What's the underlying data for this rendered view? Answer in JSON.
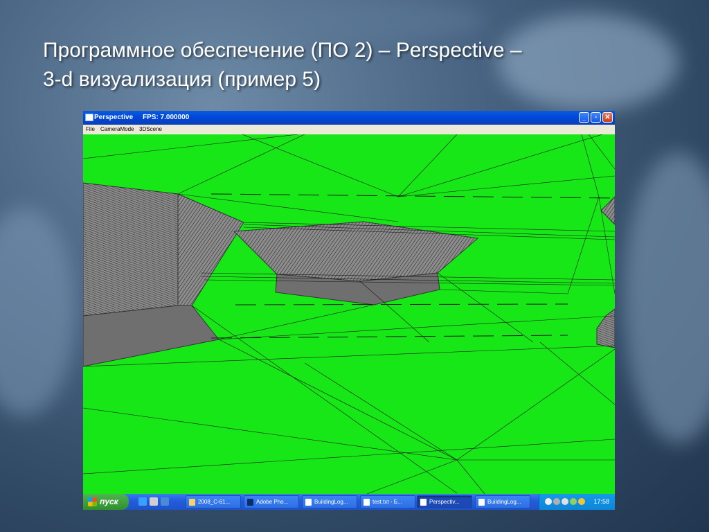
{
  "slide": {
    "title_line1": "Программное обеспечение (ПО 2) – Perspective –",
    "title_line2": "3-d визуализация (пример 5)"
  },
  "window": {
    "title": "Perspective",
    "fps_label": "FPS: 7.000000",
    "minimize_icon": "minimize-icon",
    "maximize_icon": "restore-icon",
    "close_icon": "close-icon"
  },
  "menu": {
    "file": "File",
    "camera_mode": "CameraMode",
    "scene": "3DScene"
  },
  "scene": {
    "ground_color": "#17e617",
    "building_color": "#6f6f6f",
    "line_color": "#1a1a1a"
  },
  "taskbar": {
    "start_label": "пуск",
    "tasks": [
      {
        "label": "2008_C-61...",
        "icon": "folder-icon"
      },
      {
        "label": "Adobe Pho...",
        "icon": "photoshop-icon"
      },
      {
        "label": "BuildingLog...",
        "icon": "document-icon"
      },
      {
        "label": "test.txt - Б...",
        "icon": "notepad-icon"
      },
      {
        "label": "Perspectiv...",
        "icon": "window-icon"
      },
      {
        "label": "BuildingLog...",
        "icon": "document-icon"
      }
    ],
    "clock": "17:58"
  }
}
